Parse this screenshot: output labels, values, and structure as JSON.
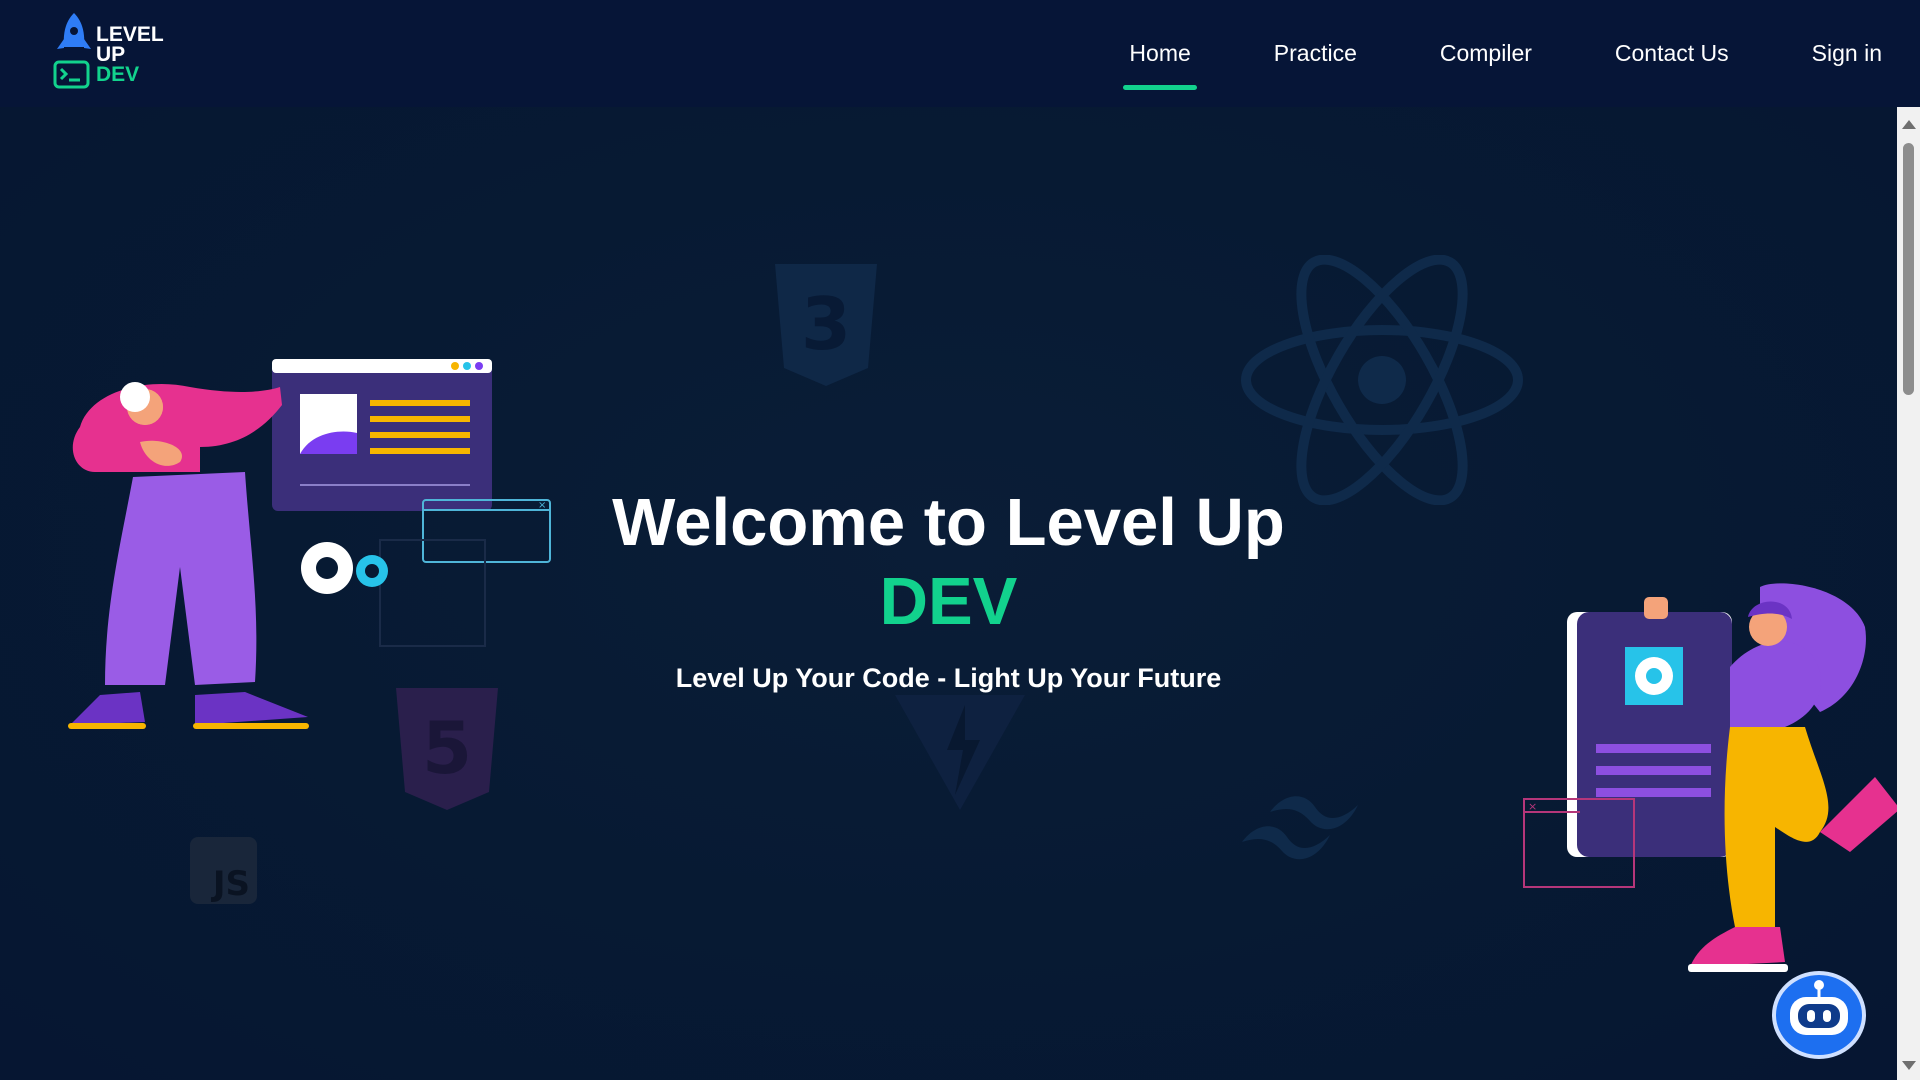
{
  "brand": {
    "logo_line1": "LEVEL",
    "logo_line2": "UP",
    "logo_line3": "DEV",
    "logo_icon": "rocket-terminal-icon"
  },
  "nav": {
    "items": [
      {
        "label": "Home",
        "active": true
      },
      {
        "label": "Practice",
        "active": false
      },
      {
        "label": "Compiler",
        "active": false
      },
      {
        "label": "Contact Us",
        "active": false
      },
      {
        "label": "Sign in",
        "active": false
      }
    ]
  },
  "hero": {
    "title": "Welcome to Level Up",
    "accent": "DEV",
    "subtitle": "Level Up Your Code - Light Up Your Future"
  },
  "background_icons": [
    "css3-icon",
    "react-icon",
    "html5-icon",
    "vite-icon",
    "tailwind-icon",
    "javascript-icon"
  ],
  "chatbot": {
    "icon": "robot-chat-icon"
  },
  "colors": {
    "nav_bg": "#061537",
    "page_bg": "#071a33",
    "accent": "#12d28d",
    "text": "#ffffff"
  }
}
